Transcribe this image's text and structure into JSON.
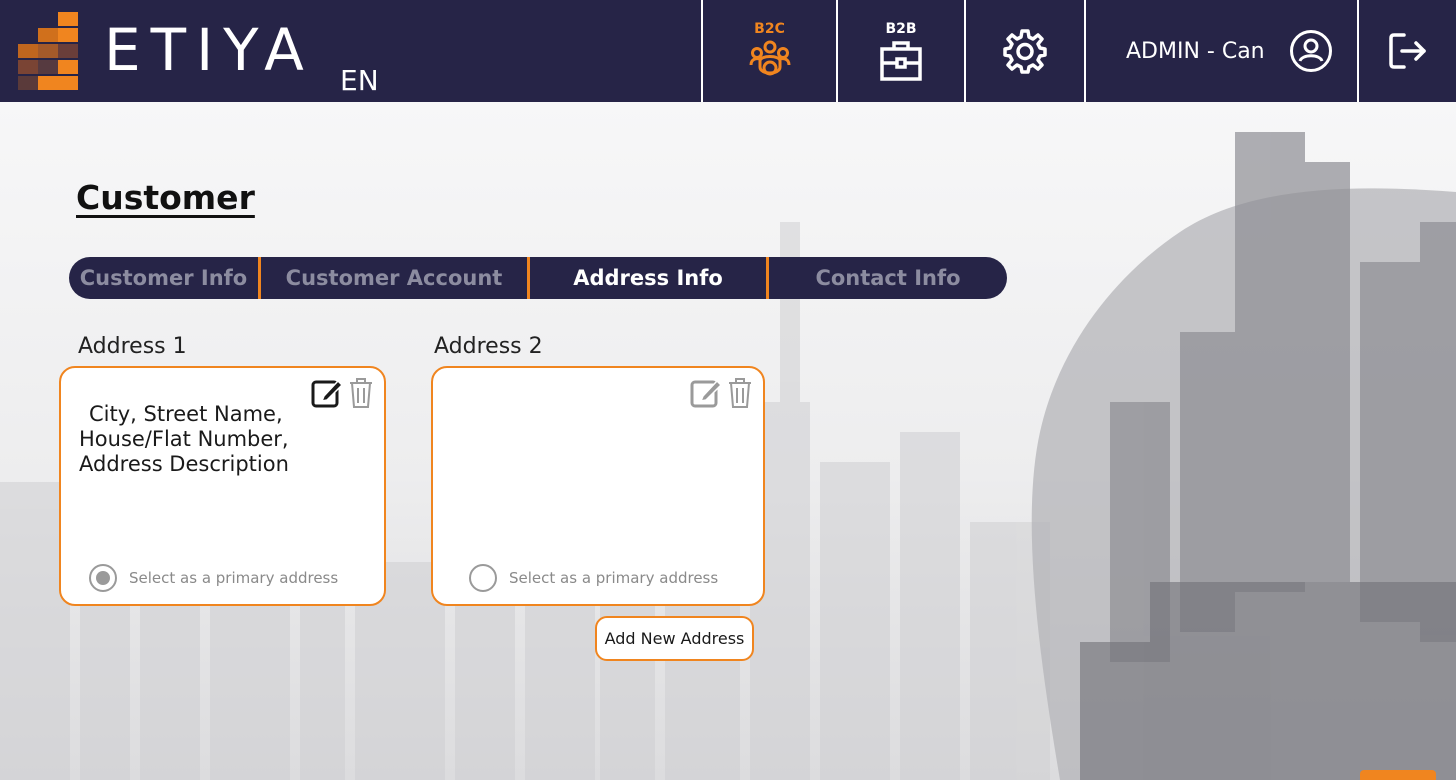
{
  "header": {
    "brand": "ETIYA",
    "language": "EN",
    "b2c_label": "B2C",
    "b2b_label": "B2B",
    "user_name": "ADMIN - Can",
    "icons": {
      "b2c": "people-group-icon",
      "b2b": "briefcase-icon",
      "settings": "gear-icon",
      "user": "user-circle-icon",
      "logout": "logout-icon"
    }
  },
  "page": {
    "title": "Customer"
  },
  "tabs": [
    {
      "label": "Customer Info",
      "active": false
    },
    {
      "label": "Customer Account",
      "active": false
    },
    {
      "label": "Address Info",
      "active": true
    },
    {
      "label": "Contact Info",
      "active": false
    }
  ],
  "addresses": [
    {
      "label": "Address 1",
      "text": "City, Street Name, House/Flat Number, Address Description",
      "primary_label": "Select as a primary address",
      "primary_selected": true
    },
    {
      "label": "Address 2",
      "text": "",
      "primary_label": "Select as a primary address",
      "primary_selected": false
    }
  ],
  "actions": {
    "add_new_address": "Add New Address"
  },
  "colors": {
    "header_bg": "#262447",
    "accent": "#f0851f",
    "tab_inactive_text": "#8c8ca0",
    "tab_active_text": "#ffffff"
  }
}
